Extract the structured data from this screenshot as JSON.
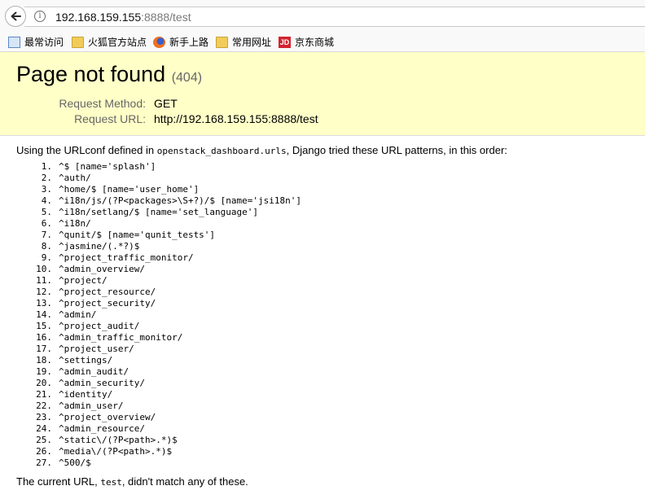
{
  "browser": {
    "url_host": "192.168.159.155",
    "url_rest": ":8888/test",
    "info_icon": "info-icon",
    "back_icon": "back-arrow-icon"
  },
  "bookmarks": [
    {
      "label": "最常访问",
      "icon": "most-visited-icon"
    },
    {
      "label": "火狐官方站点",
      "icon": "folder-icon"
    },
    {
      "label": "新手上路",
      "icon": "firefox-icon"
    },
    {
      "label": "常用网址",
      "icon": "folder-icon"
    },
    {
      "label": "京东商城",
      "icon": "jd-icon",
      "icon_text": "JD"
    }
  ],
  "summary": {
    "title": "Page not found",
    "code": "(404)",
    "request_method_label": "Request Method:",
    "request_method": "GET",
    "request_url_label": "Request URL:",
    "request_url": "http://192.168.159.155:8888/test"
  },
  "info": {
    "prefix": "Using the URLconf defined in ",
    "urlconf": "openstack_dashboard.urls",
    "suffix": ", Django tried these URL patterns, in this order:"
  },
  "patterns": [
    "^$ [name='splash']",
    "^auth/",
    "^home/$ [name='user_home']",
    "^i18n/js/(?P<packages>\\S+?)/$ [name='jsi18n']",
    "^i18n/setlang/$ [name='set_language']",
    "^i18n/",
    "^qunit/$ [name='qunit_tests']",
    "^jasmine/(.*?)$",
    "^project_traffic_monitor/",
    "^admin_overview/",
    "^project/",
    "^project_resource/",
    "^project_security/",
    "^admin/",
    "^project_audit/",
    "^admin_traffic_monitor/",
    "^project_user/",
    "^settings/",
    "^admin_audit/",
    "^admin_security/",
    "^identity/",
    "^admin_user/",
    "^project_overview/",
    "^admin_resource/",
    "^static\\/(?P<path>.*)$",
    "^media\\/(?P<path>.*)$",
    "^500/$"
  ],
  "footer": {
    "prefix": "The current URL, ",
    "path": "test",
    "suffix": ", didn't match any of these."
  }
}
